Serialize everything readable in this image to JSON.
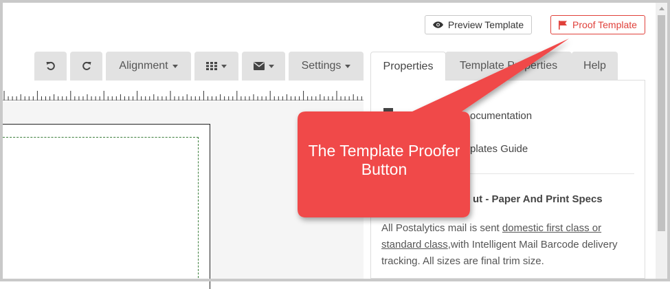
{
  "header": {
    "preview_label": "Preview Template",
    "proof_label": "Proof Template"
  },
  "toolbar": {
    "alignment_label": "Alignment",
    "settings_label": "Settings"
  },
  "tabs": [
    {
      "label": "Properties"
    },
    {
      "label": "Template Properties"
    },
    {
      "label": "Help"
    }
  ],
  "panel": {
    "link1": "ocumentation",
    "link2": "plates Guide",
    "section_title": "ut - Paper And Print Specs",
    "text_pre": "All Postalytics mail is sent ",
    "text_link1": "domestic first class or",
    "text_link2": "standard class",
    "text_post": ",with Intelligent Mail Barcode delivery tracking. All sizes are final trim size."
  },
  "callout": {
    "text": "The Template Proofer Button",
    "color": "#f04848"
  },
  "colors": {
    "proof_red": "#e0403a",
    "toolbar_gray": "#e2e2e2"
  },
  "icons": {
    "preview": "eye-icon",
    "proof": "flag-icon",
    "undo": "undo-icon",
    "redo": "redo-icon",
    "grid": "grid-icon",
    "mail": "envelope-icon"
  }
}
